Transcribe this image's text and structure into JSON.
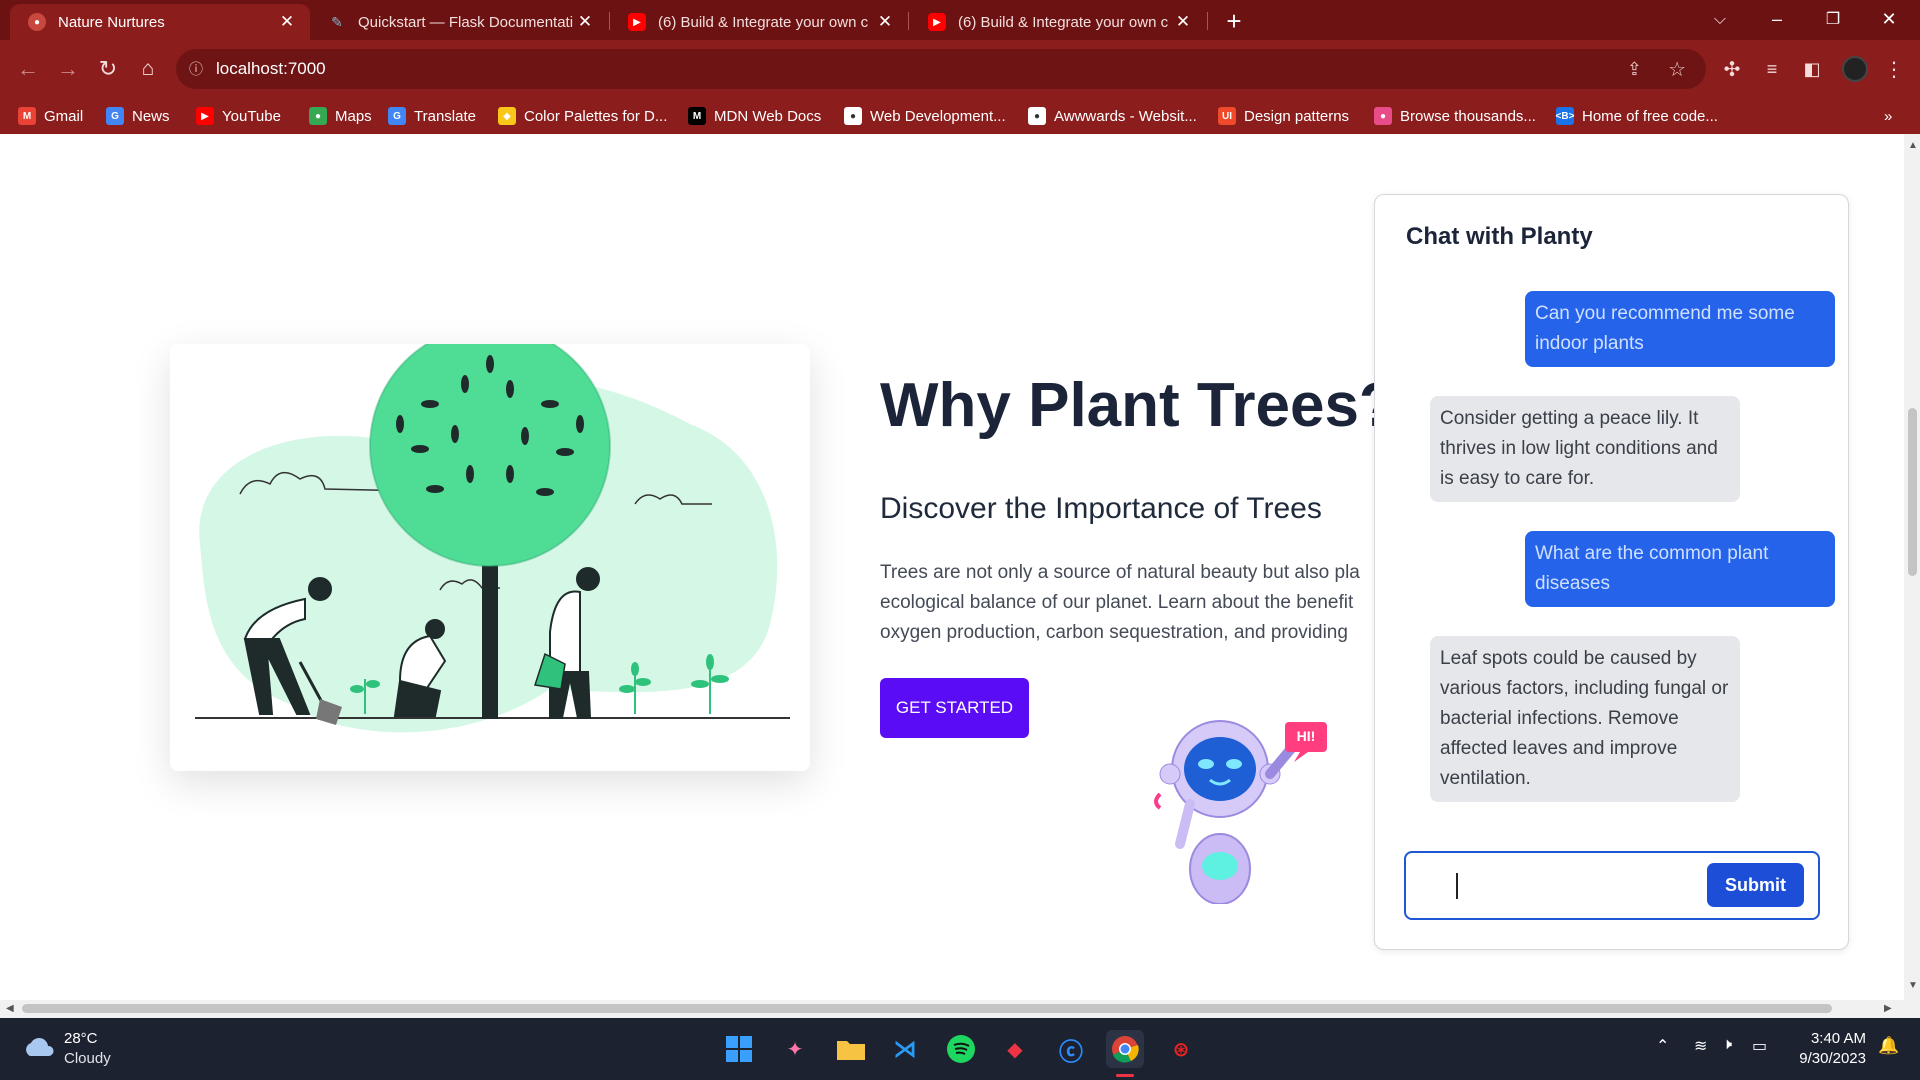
{
  "browser": {
    "tabs": [
      {
        "title": "Nature Nurtures",
        "active": true,
        "favicon": "nature-icon"
      },
      {
        "title": "Quickstart — Flask Documentati",
        "active": false,
        "favicon": "flask-icon"
      },
      {
        "title": "(6) Build & Integrate your own c",
        "active": false,
        "favicon": "youtube-icon"
      },
      {
        "title": "(6) Build & Integrate your own c",
        "active": false,
        "favicon": "youtube-icon"
      }
    ],
    "address": "localhost:7000",
    "bookmarks": [
      {
        "label": "Gmail",
        "icon": "gmail-icon",
        "color": "#ea4335",
        "glyph": "M"
      },
      {
        "label": "News",
        "icon": "news-icon",
        "color": "#4285f4",
        "glyph": "G"
      },
      {
        "label": "YouTube",
        "icon": "youtube-icon",
        "color": "#ff0000",
        "glyph": "▶"
      },
      {
        "label": "Maps",
        "icon": "maps-icon",
        "color": "#34a853",
        "glyph": "●"
      },
      {
        "label": "Translate",
        "icon": "translate-icon",
        "color": "#4285f4",
        "glyph": "G"
      },
      {
        "label": "Color Palettes for D...",
        "icon": "palette-icon",
        "color": "#f9c61a",
        "glyph": "◆"
      },
      {
        "label": "MDN Web Docs",
        "icon": "mdn-icon",
        "color": "#000000",
        "glyph": "M"
      },
      {
        "label": "Web Development...",
        "icon": "webdev-icon",
        "color": "#ffffff",
        "glyph": "●"
      },
      {
        "label": "Awwwards - Websit...",
        "icon": "awwwards-icon",
        "color": "#ffffff",
        "glyph": "●"
      },
      {
        "label": "Design patterns",
        "icon": "ui-icon",
        "color": "#f04a2a",
        "glyph": "UI"
      },
      {
        "label": "Browse thousands...",
        "icon": "dribbble-icon",
        "color": "#ea4c89",
        "glyph": "●"
      },
      {
        "label": "Home of free code...",
        "icon": "code-icon",
        "color": "#1a73e8",
        "glyph": "&lt;B&gt;"
      }
    ],
    "more_bookmarks": "»"
  },
  "hero": {
    "title": "Why Plant Trees?",
    "subtitle": "Discover the Importance of Trees",
    "body_lines": [
      "Trees are not only a source of natural beauty but also pla",
      "ecological balance of our planet. Learn about the benefit",
      "oxygen production, carbon sequestration, and providing"
    ],
    "cta_label": "GET STARTED",
    "robot_badge": "HI!"
  },
  "chat": {
    "title": "Chat with Planty",
    "messages": [
      {
        "role": "user",
        "text": "Can you recommend me some indoor plants"
      },
      {
        "role": "bot",
        "text": "Consider getting a peace lily. It thrives in low light conditions and is easy to care for."
      },
      {
        "role": "user",
        "text": "What are the common plant diseases"
      },
      {
        "role": "bot",
        "text": "Leaf spots could be caused by various factors, including fungal or bacterial infections. Remove affected leaves and improve ventilation."
      }
    ],
    "input_value": "",
    "submit_label": "Submit"
  },
  "taskbar": {
    "temperature": "28°C",
    "weather": "Cloudy",
    "time": "3:40 AM",
    "date": "9/30/2023"
  }
}
